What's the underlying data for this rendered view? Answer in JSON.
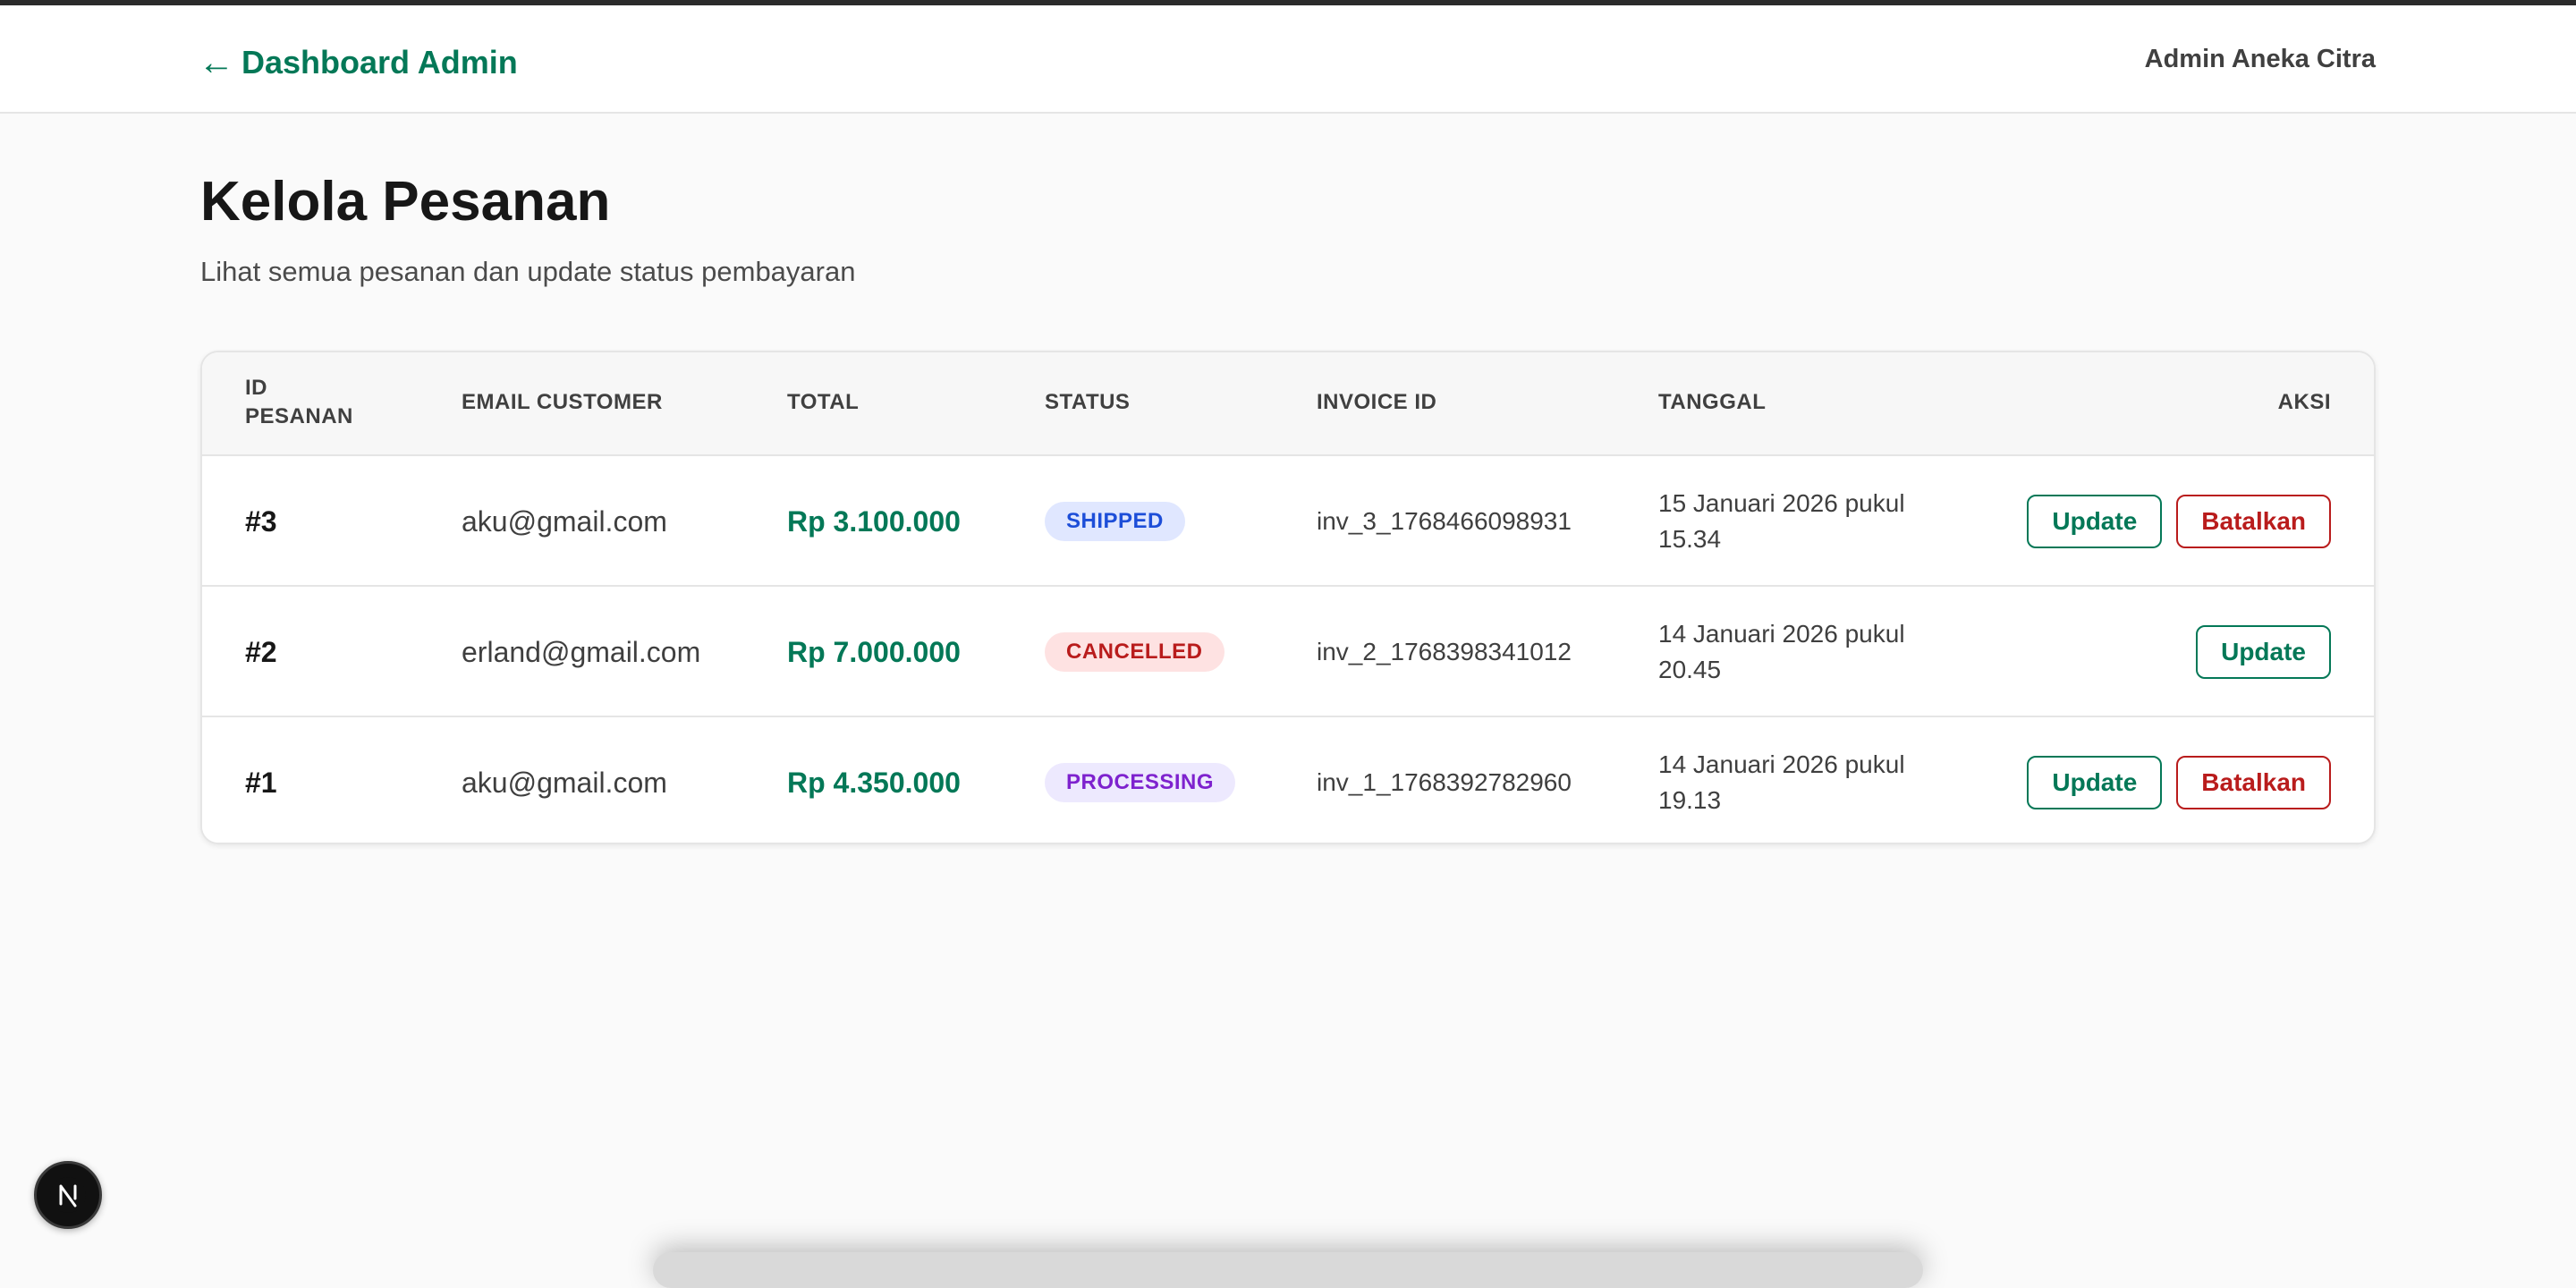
{
  "header": {
    "back_arrow": "←",
    "back_label": "Dashboard Admin",
    "admin_name": "Admin Aneka Citra"
  },
  "page": {
    "title": "Kelola Pesanan",
    "subtitle": "Lihat semua pesanan dan update status pembayaran"
  },
  "table": {
    "columns": {
      "id_line1": "ID",
      "id_line2": "PESANAN",
      "email": "EMAIL CUSTOMER",
      "total": "TOTAL",
      "status": "STATUS",
      "invoice": "INVOICE ID",
      "date": "TANGGAL",
      "actions": "AKSI"
    },
    "rows": [
      {
        "id": "#3",
        "email": "aku@gmail.com",
        "total": "Rp 3.100.000",
        "status": "SHIPPED",
        "invoice": "inv_3_1768466098931",
        "date_line1": "15 Januari 2026 pukul",
        "date_line2": "15.34",
        "update_label": "Update",
        "cancel_label": "Batalkan"
      },
      {
        "id": "#2",
        "email": "erland@gmail.com",
        "total": "Rp 7.000.000",
        "status": "CANCELLED",
        "invoice": "inv_2_1768398341012",
        "date_line1": "14 Januari 2026 pukul",
        "date_line2": "20.45",
        "update_label": "Update"
      },
      {
        "id": "#1",
        "email": "aku@gmail.com",
        "total": "Rp 4.350.000",
        "status": "PROCESSING",
        "invoice": "inv_1_1768392782960",
        "date_line1": "14 Januari 2026 pukul",
        "date_line2": "19.13",
        "update_label": "Update",
        "cancel_label": "Batalkan"
      }
    ]
  },
  "colors": {
    "accent": "#047857",
    "danger": "#b91c1c",
    "shipped": "#1d4ed8",
    "processing": "#7e22ce"
  },
  "icons": {
    "dev_badge": "nextjs-logo-icon"
  }
}
